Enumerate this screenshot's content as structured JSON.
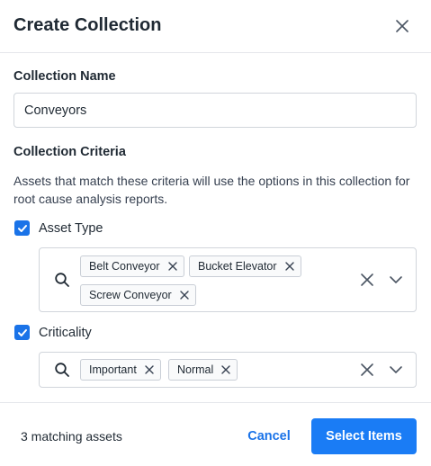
{
  "dialog": {
    "title": "Create Collection"
  },
  "collection_name": {
    "label": "Collection Name",
    "value": "Conveyors"
  },
  "criteria": {
    "label": "Collection Criteria",
    "description": "Assets that match these criteria will use the options in this collection for root cause analysis reports.",
    "asset_type": {
      "label": "Asset Type",
      "checked": true,
      "chips": [
        "Belt Conveyor",
        "Bucket Elevator",
        "Screw Conveyor"
      ]
    },
    "criticality": {
      "label": "Criticality",
      "checked": true,
      "chips": [
        "Important",
        "Normal"
      ]
    }
  },
  "footer": {
    "match_count": "3 matching assets",
    "cancel_label": "Cancel",
    "select_label": "Select Items"
  },
  "colors": {
    "accent": "#1a73e8",
    "primary_button": "#1a7cf5"
  },
  "icons": {
    "close": "close-icon",
    "search": "search-icon",
    "chip_remove": "x-icon",
    "clear": "clear-icon",
    "dropdown": "chevron-down-icon",
    "checkbox": "checkmark-icon"
  }
}
